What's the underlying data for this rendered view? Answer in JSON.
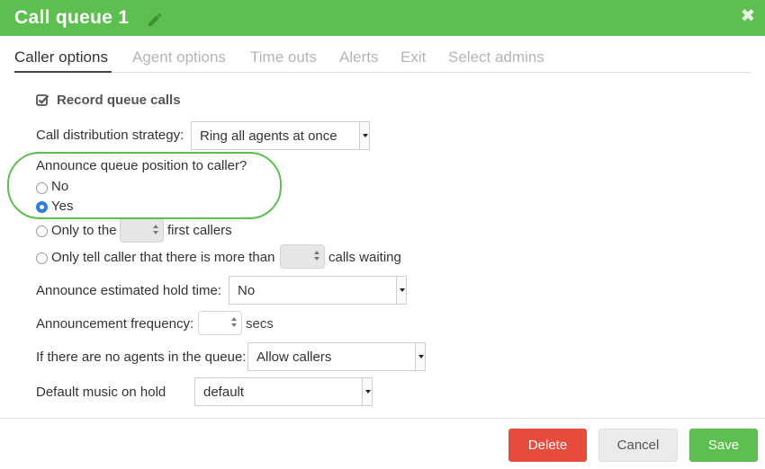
{
  "dialog": {
    "title": "Call queue 1"
  },
  "tabs": [
    {
      "label": "Caller options"
    },
    {
      "label": "Agent options"
    },
    {
      "label": "Time outs"
    },
    {
      "label": "Alerts"
    },
    {
      "label": "Exit"
    },
    {
      "label": "Select admins"
    }
  ],
  "record_queue_calls": {
    "label": "Record queue calls",
    "checked": true
  },
  "distribution": {
    "label": "Call distribution strategy:",
    "value": "Ring all agents at once"
  },
  "announce_position": {
    "label": "Announce queue position to caller?",
    "options": [
      {
        "label": "No",
        "checked": false
      },
      {
        "label": "Yes",
        "checked": true
      },
      {
        "label_before": "Only to the",
        "label_after": "first callers",
        "checked": false
      },
      {
        "label_before": "Only tell caller that there is more than",
        "label_after": "calls waiting",
        "checked": false
      }
    ]
  },
  "hold_time": {
    "label": "Announce estimated hold time:",
    "value": "No"
  },
  "frequency": {
    "label": "Announcement frequency:",
    "unit": "secs"
  },
  "no_agents": {
    "label": "If there are no agents in the queue:",
    "value": "Allow callers"
  },
  "music": {
    "label": "Default music on hold",
    "value": "default"
  },
  "footer": {
    "delete_label": "Delete",
    "cancel_label": "Cancel",
    "save_label": "Save"
  },
  "colors": {
    "brand_green": "#5cbf4f",
    "danger_red": "#e84c3d",
    "radio_blue": "#2f7de1"
  }
}
